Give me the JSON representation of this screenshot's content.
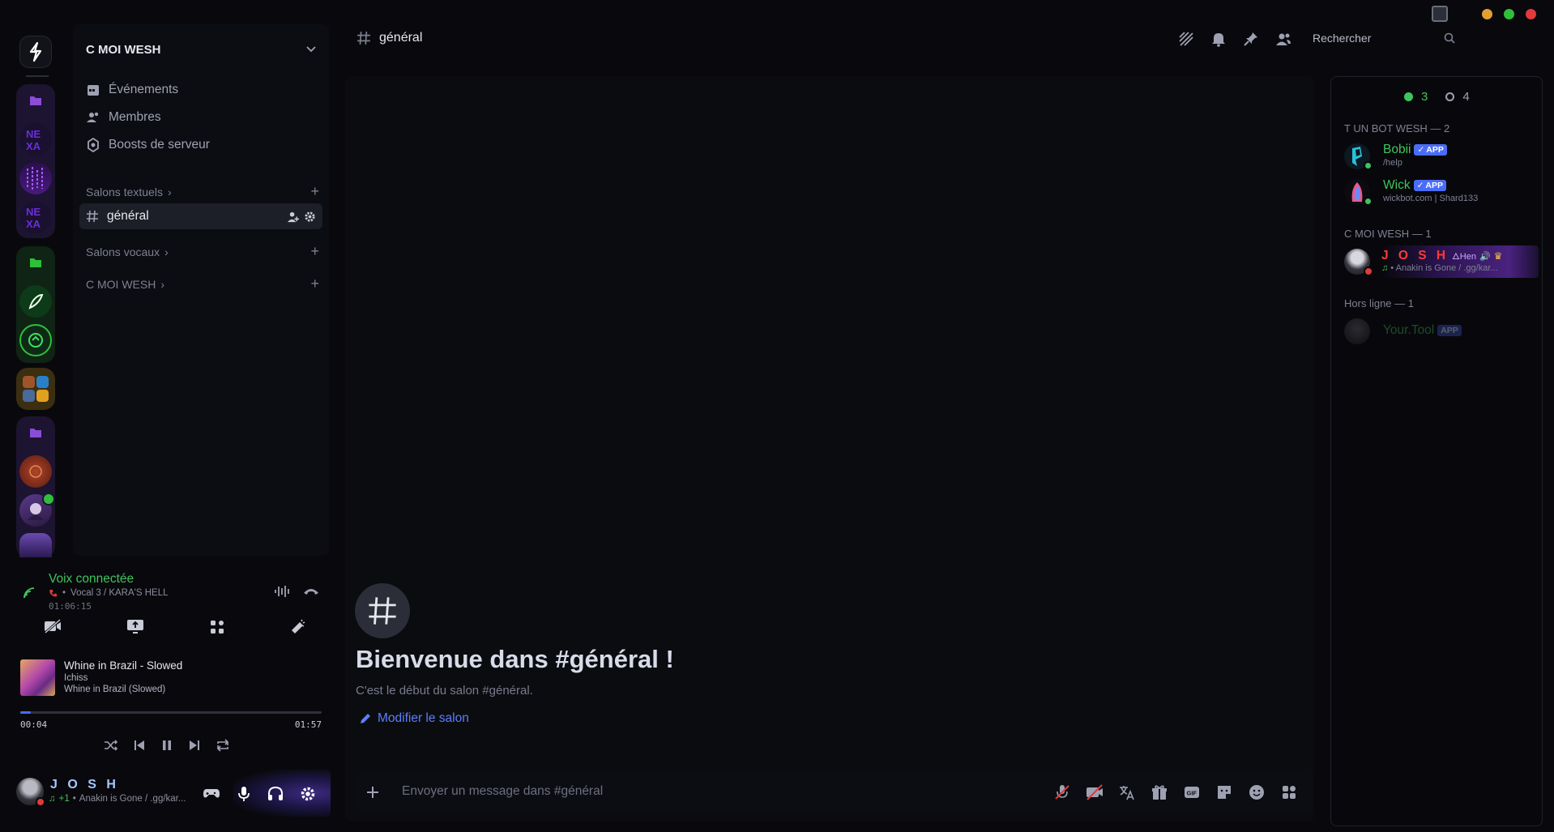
{
  "window": {
    "controls": {
      "minimize_color": "#e0a030",
      "maximize_color": "#2fbf3a",
      "close_color": "#e23a3a"
    }
  },
  "colors": {
    "accent": "#4a6cf7",
    "online": "#3fc45c",
    "dnd": "#e03a3a",
    "link": "#5d7ff9"
  },
  "guild": {
    "name": "C MOI WESH",
    "menu": [
      {
        "label": "Événements",
        "icon": "calendar-icon"
      },
      {
        "label": "Membres",
        "icon": "members-icon"
      },
      {
        "label": "Boosts de serveur",
        "icon": "boost-icon"
      }
    ],
    "categories": {
      "text": "Salons textuels",
      "voice": "Salons vocaux",
      "custom": "C MOI WESH"
    },
    "active_channel": "général"
  },
  "voice": {
    "title": "Voix connectée",
    "channel": "Vocal 3 / KARA'S HELL",
    "elapsed": "01:06:15"
  },
  "player": {
    "title": "Whine in Brazil - Slowed",
    "artist": "Ichiss",
    "album": "Whine in Brazil (Slowed)",
    "current": "00:04",
    "duration": "01:57",
    "progress": 0.034
  },
  "user": {
    "name": "J O S H",
    "status_extra": "+1",
    "status": "Anakin is Gone / .gg/kar..."
  },
  "topbar": {
    "channel": "général",
    "search_placeholder": "Rechercher"
  },
  "welcome": {
    "title": "Bienvenue dans #général !",
    "subtitle": "C'est le début du salon #général.",
    "edit": "Modifier le salon"
  },
  "composer": {
    "placeholder": "Envoyer un message dans #général"
  },
  "members": {
    "online_count": "3",
    "offline_count": "4",
    "groups": [
      {
        "title": "T UN BOT WESH — 2",
        "members": [
          {
            "name": "Bobii",
            "badge": "APP",
            "sub": "/help"
          },
          {
            "name": "Wick",
            "badge": "APP",
            "sub": "wickbot.com | Shard133"
          }
        ]
      },
      {
        "title": "C MOI WESH — 1",
        "members": [
          {
            "name": "J O S H",
            "tag": "Hen",
            "sub": "Anakin is Gone / .gg/kar..."
          }
        ]
      },
      {
        "title": "Hors ligne — 1",
        "members": [
          {
            "name": "Your.Tool",
            "badge": "APP"
          }
        ]
      }
    ]
  }
}
